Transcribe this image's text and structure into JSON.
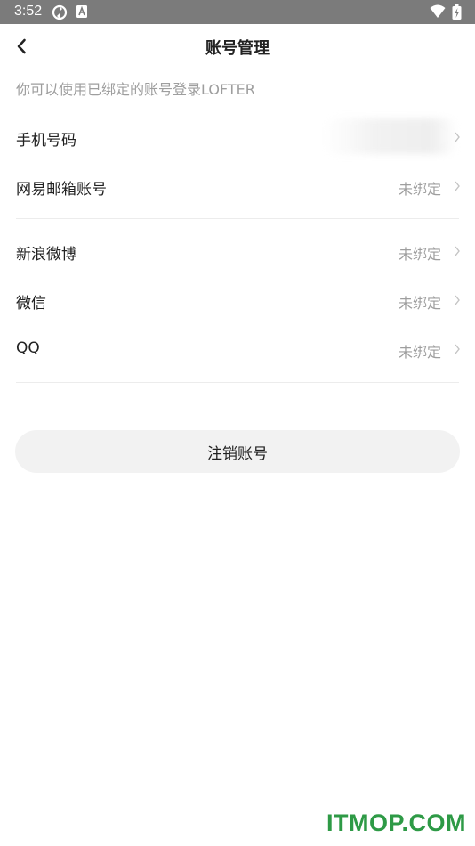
{
  "status_bar": {
    "time": "3:52",
    "icons_left": [
      "sync-icon",
      "a-badge-icon"
    ],
    "icons_right": [
      "wifi-icon",
      "battery-charging-icon"
    ]
  },
  "header": {
    "back_icon": "chevron-left-icon",
    "title": "账号管理"
  },
  "hint": "你可以使用已绑定的账号登录LOFTER",
  "accounts_group1": [
    {
      "label": "手机号码",
      "status": ""
    },
    {
      "label": "网易邮箱账号",
      "status": "未绑定"
    }
  ],
  "accounts_group2": [
    {
      "label": "新浪微博",
      "status": "未绑定"
    },
    {
      "label": "微信",
      "status": "未绑定"
    },
    {
      "label": "QQ",
      "status": "未绑定"
    }
  ],
  "deregister_label": "注销账号",
  "watermark": "ITMOP.COM",
  "colors": {
    "status_bar": "#7b7b7b",
    "text_primary": "#222222",
    "text_secondary": "#9e9e9e",
    "divider": "#ececec",
    "button_bg": "#f2f2f2",
    "watermark": "#2e9a46"
  }
}
